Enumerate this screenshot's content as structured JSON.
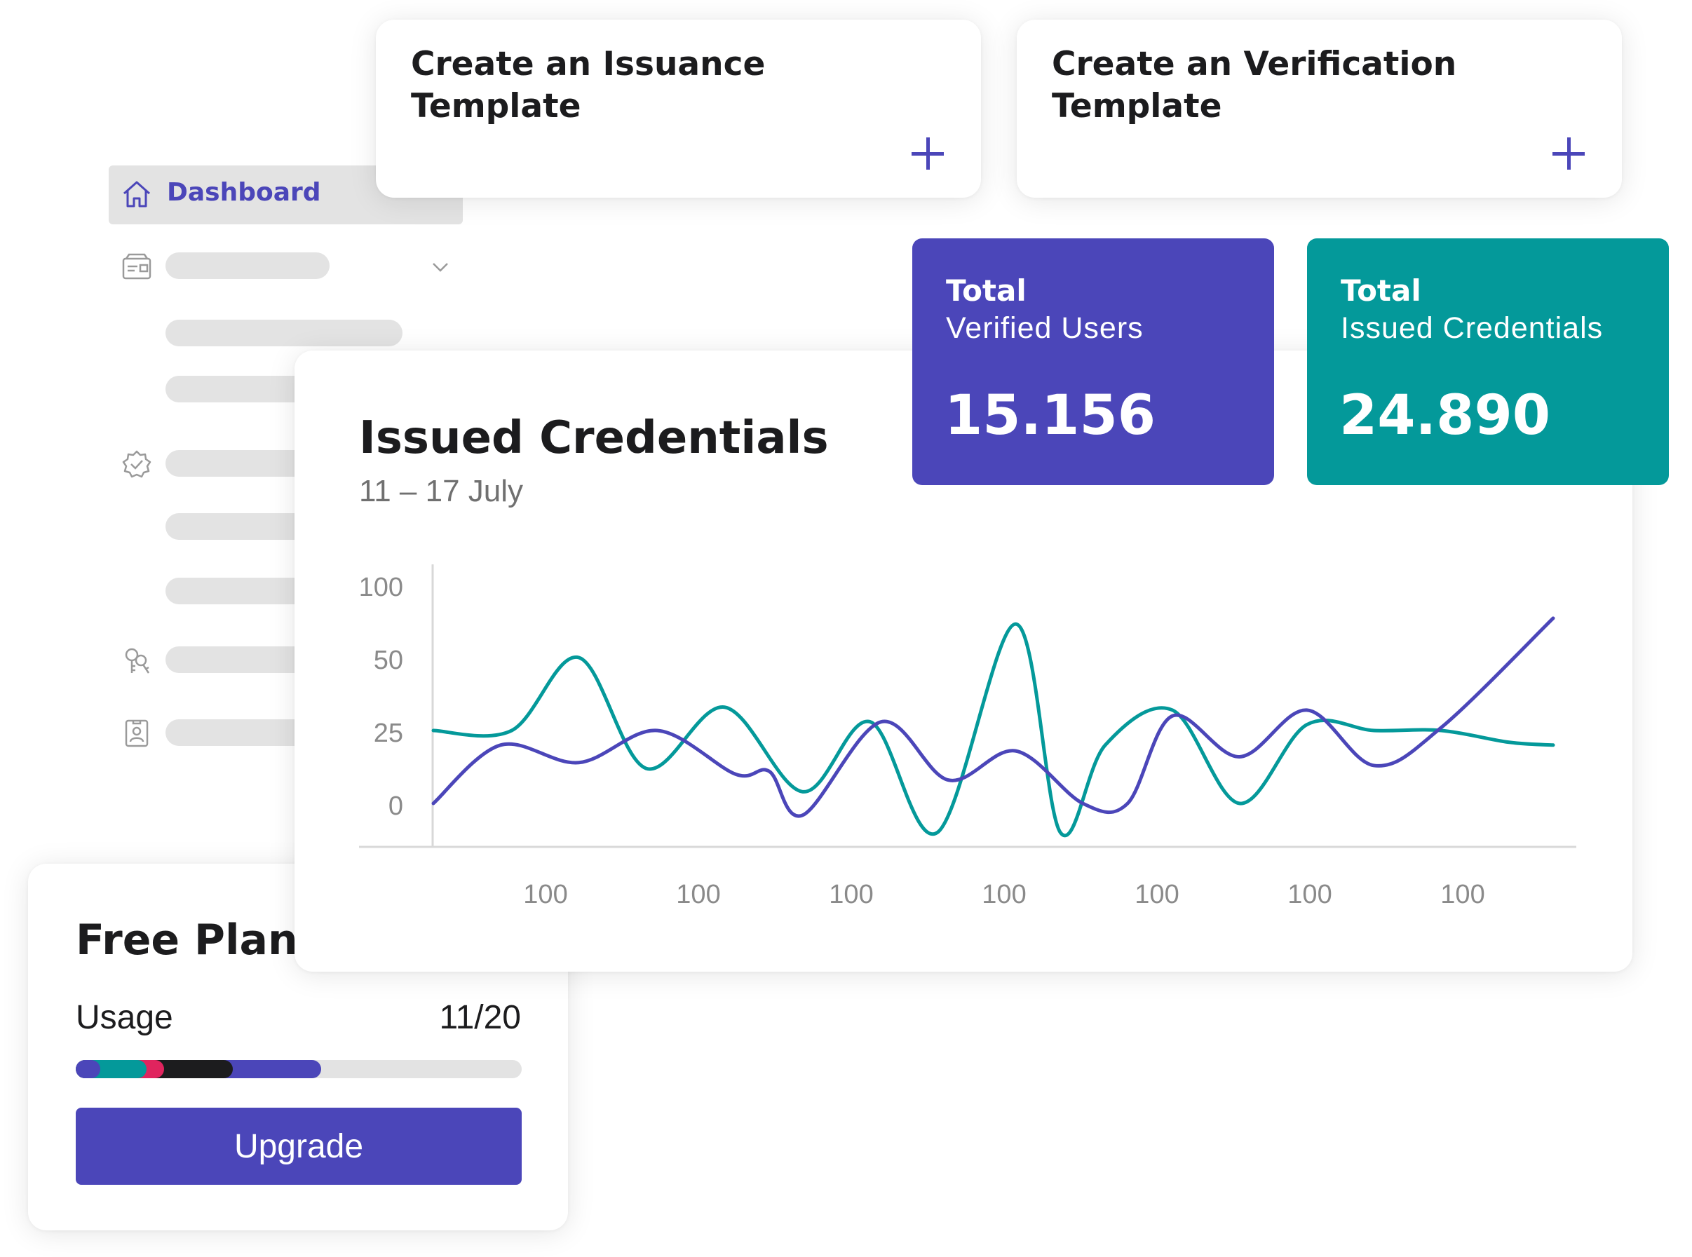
{
  "templates": {
    "issuance": {
      "title": "Create an Issuance Template"
    },
    "verification": {
      "title": "Create an Verification Template"
    }
  },
  "sidebar": {
    "active_label": "Dashboard",
    "icons": [
      "home-icon",
      "wallet-icon",
      "chevron-down-icon",
      "badge-check-icon",
      "keys-icon",
      "id-badge-icon"
    ]
  },
  "stats": {
    "verified": {
      "label_bold": "Total",
      "label": "Verified Users",
      "value": "15.156",
      "color": "#4b46b9"
    },
    "issued": {
      "label_bold": "Total",
      "label": "Issued Credentials",
      "value": "24.890",
      "color": "#04999a"
    }
  },
  "chart": {
    "title": "Issued Credentials",
    "subtitle": "11 – 17 July"
  },
  "chart_data": {
    "type": "line",
    "y_tick_labels": [
      "100",
      "50",
      "25",
      "0"
    ],
    "x_tick_labels": [
      "100",
      "100",
      "100",
      "100",
      "100",
      "100",
      "100"
    ],
    "ylim": [
      0,
      100
    ],
    "grid": false,
    "series": [
      {
        "color": "#04999a",
        "x": [
          0,
          0.07,
          0.13,
          0.19,
          0.26,
          0.33,
          0.39,
          0.45,
          0.52,
          0.56,
          0.6,
          0.66,
          0.72,
          0.78,
          0.84,
          0.9,
          0.96,
          1.0
        ],
        "values": [
          25,
          25,
          50,
          12,
          33,
          4,
          28,
          -10,
          73,
          -10,
          20,
          32,
          0,
          27,
          25,
          25,
          21,
          20
        ]
      },
      {
        "color": "#4b46b9",
        "x": [
          0,
          0.06,
          0.13,
          0.2,
          0.27,
          0.3,
          0.33,
          0.4,
          0.46,
          0.52,
          0.58,
          0.62,
          0.66,
          0.72,
          0.78,
          0.84,
          0.9,
          1.0
        ],
        "values": [
          0,
          20,
          14,
          25,
          10,
          11,
          -4,
          28,
          8,
          18,
          0,
          0,
          30,
          16,
          32,
          13,
          26,
          77
        ]
      }
    ]
  },
  "plan": {
    "title": "Free Plan",
    "usage_label": "Usage",
    "usage_value": "11/20",
    "usage_fraction": 0.55,
    "segment_colors": [
      "#4b46b9",
      "#04999a",
      "#e0245e",
      "#1c1c1e",
      "#4b46b9"
    ],
    "upgrade_label": "Upgrade"
  }
}
